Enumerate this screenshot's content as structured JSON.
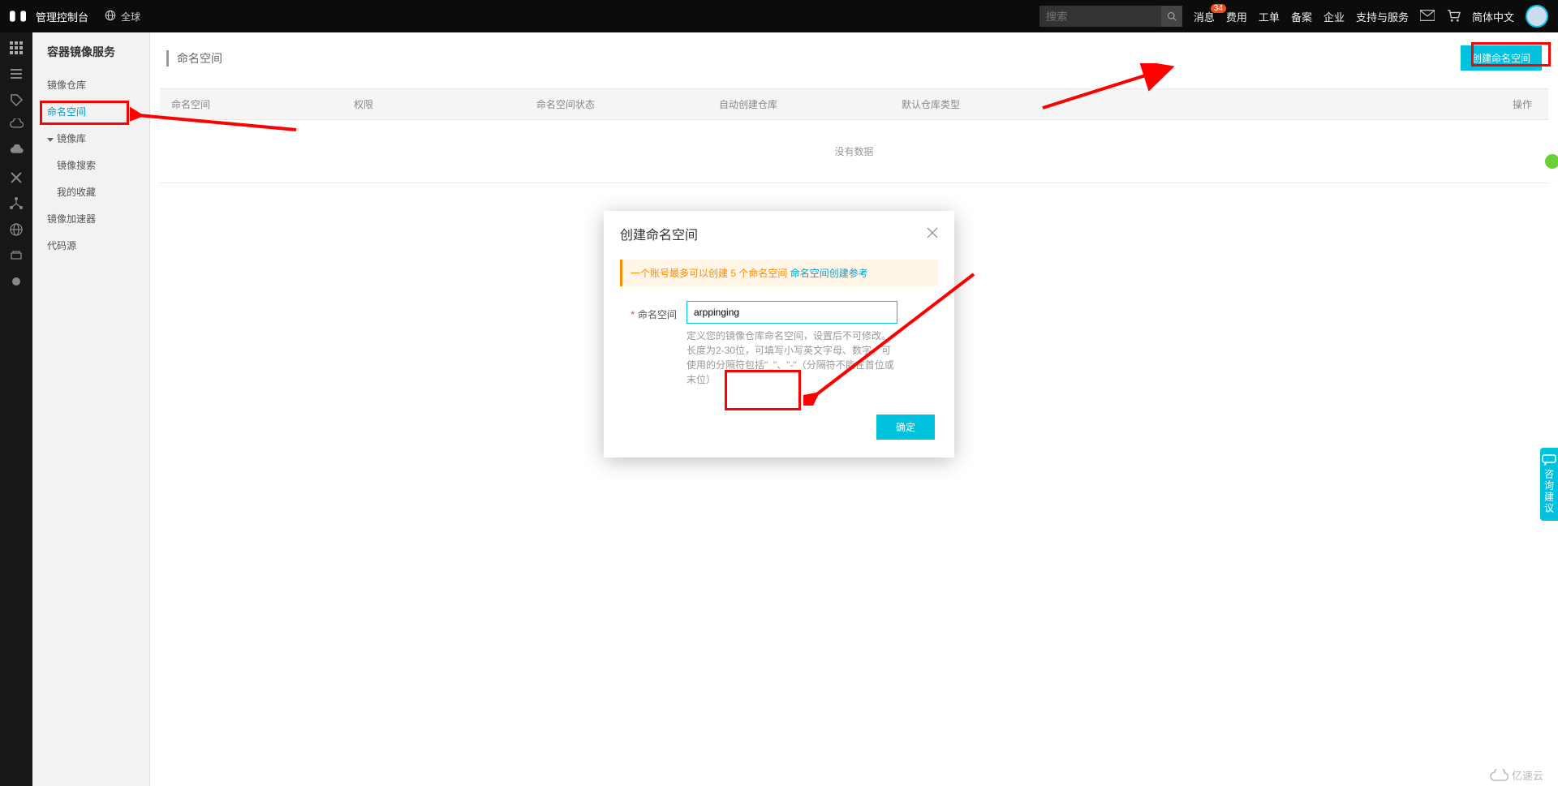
{
  "colors": {
    "accent": "#00c1de",
    "badge": "#f25022",
    "annotation": "#ff0000"
  },
  "header": {
    "console": "管理控制台",
    "region": "全球",
    "search_placeholder": "搜索",
    "nav": {
      "messages": "消息",
      "messages_count": "34",
      "fees": "费用",
      "orders": "工单",
      "filing": "备案",
      "enterprise": "企业",
      "support_services": "支持与服务",
      "language": "简体中文"
    }
  },
  "sidebar": {
    "title": "容器镜像服务",
    "items": [
      {
        "label": "镜像仓库"
      },
      {
        "label": "命名空间",
        "active": true
      },
      {
        "label": "镜像库",
        "group": true
      },
      {
        "label": "镜像搜索",
        "sub": true
      },
      {
        "label": "我的收藏",
        "sub": true
      },
      {
        "label": "镜像加速器"
      },
      {
        "label": "代码源"
      }
    ]
  },
  "main": {
    "breadcrumb": "命名空间",
    "create_button": "创建命名空间",
    "columns": {
      "namespace": "命名空间",
      "permission": "权限",
      "status": "命名空间状态",
      "auto_create": "自动创建仓库",
      "default_type": "默认仓库类型",
      "actions": "操作"
    },
    "empty": "没有数据"
  },
  "modal": {
    "title": "创建命名空间",
    "alert_prefix": "一个账号最多可以创建 5 个命名空间",
    "alert_link": "命名空间创建参考",
    "field_label": "命名空间",
    "input_value": "arppinging",
    "help": "定义您的镜像仓库命名空间，设置后不可修改。长度为2-30位，可填写小写英文字母、数字，可使用的分隔符包括\"_\"、\"-\"（分隔符不能在首位或末位）",
    "ok": "确定"
  },
  "side_tab": {
    "text": "咨询建议"
  },
  "watermark": "亿速云"
}
